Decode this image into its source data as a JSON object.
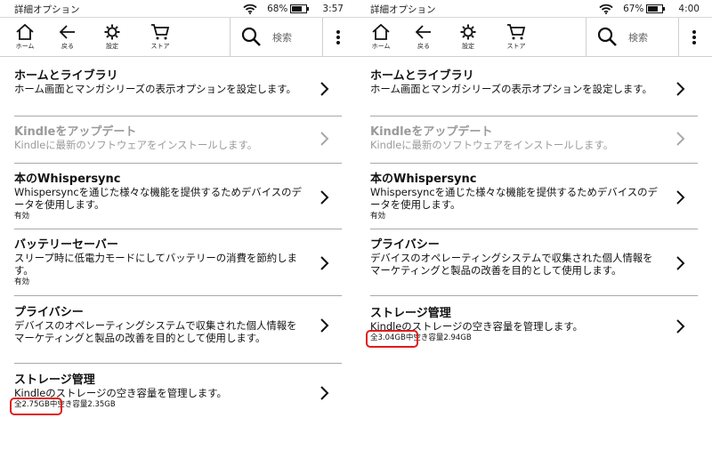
{
  "screens": [
    {
      "status": {
        "title": "詳細オプション",
        "battery": "68%",
        "time": "3:57"
      },
      "toolbar": {
        "home": "ホーム",
        "back": "戻る",
        "settings": "設定",
        "store": "ストア",
        "search_placeholder": "検索"
      },
      "rows": [
        {
          "title": "ホームとライブラリ",
          "desc": "ホーム画面とマンガシリーズの表示オプションを設定します。",
          "sub": "",
          "disabled": false
        },
        {
          "title": "Kindleをアップデート",
          "desc": "Kindleに最新のソフトウェアをインストールします。",
          "sub": "",
          "disabled": true
        },
        {
          "title": "本のWhispersync",
          "desc": "Whispersyncを通じた様々な機能を提供するためデバイスのデータを使用します。",
          "sub": "有効",
          "disabled": false
        },
        {
          "title": "バッテリーセーバー",
          "desc": "スリープ時に低電力モードにしてバッテリーの消費を節約します。",
          "sub": "有効",
          "disabled": false
        },
        {
          "title": "プライバシー",
          "desc": "デバイスのオペレーティングシステムで収集された個人情報をマーケティングと製品の改善を目的として使用します。",
          "sub": "",
          "disabled": false
        },
        {
          "title": "ストレージ管理",
          "desc": "Kindleのストレージの空き容量を管理します。",
          "sub": "全2.75GB中空き容量2.35GB",
          "disabled": false
        }
      ]
    },
    {
      "status": {
        "title": "詳細オプション",
        "battery": "67%",
        "time": "4:00"
      },
      "toolbar": {
        "home": "ホーム",
        "back": "戻る",
        "settings": "設定",
        "store": "ストア",
        "search_placeholder": "検索"
      },
      "rows": [
        {
          "title": "ホームとライブラリ",
          "desc": "ホーム画面とマンガシリーズの表示オプションを設定します。",
          "sub": "",
          "disabled": false
        },
        {
          "title": "Kindleをアップデート",
          "desc": "Kindleに最新のソフトウェアをインストールします。",
          "sub": "",
          "disabled": true
        },
        {
          "title": "本のWhispersync",
          "desc": "Whispersyncを通じた様々な機能を提供するためデバイスのデータを使用します。",
          "sub": "有効",
          "disabled": false
        },
        {
          "title": "プライバシー",
          "desc": "デバイスのオペレーティングシステムで収集された個人情報をマーケティングと製品の改善を目的として使用します。",
          "sub": "",
          "disabled": false
        },
        {
          "title": "ストレージ管理",
          "desc": "Kindleのストレージの空き容量を管理します。",
          "sub": "全3.04GB中空き容量2.94GB",
          "disabled": false
        }
      ]
    }
  ],
  "colors": {
    "highlight": "#e21b1b",
    "divider": "#a9a9a9",
    "disabled_text": "#9a9a9a"
  },
  "icons": [
    "wifi-icon",
    "battery-icon",
    "home-icon",
    "back-arrow-icon",
    "settings-gear-icon",
    "store-cart-icon",
    "search-icon",
    "more-menu-icon",
    "chevron-right-icon"
  ]
}
